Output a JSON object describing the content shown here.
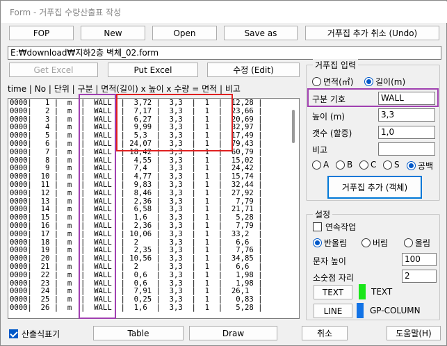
{
  "window": {
    "title": "Form - 거푸집 수량산출표 작성"
  },
  "toolbar": {
    "fop": "FOP",
    "new": "New",
    "open": "Open",
    "save_as": "Save as",
    "undo": "거푸집 추가 취소 (Undo)"
  },
  "path": "E:₩download₩지하2층 벽체_02.form",
  "actions": {
    "get_excel": "Get Excel",
    "put_excel": "Put Excel",
    "edit": "수정 (Edit)"
  },
  "list": {
    "header": "time | No | 단위 | 구분 | 면적(길이) x 높이 x 수량 = 면적 | 비고",
    "rows": [
      "0000|   1 |  m  |  WALL  |  3,72 |  3,3  |  1  |  12,28 |",
      "0000|   2 |  m  |  WALL  |  7,17 |  3,3  |  1  |  23,66 |",
      "0000|   3 |  m  |  WALL  |  6,27 |  3,3  |  1  |  20,69 |",
      "0000|   4 |  m  |  WALL  |  9,99 |  3,3  |  1  |  32,97 |",
      "0000|   5 |  m  |  WALL  |  5,3  |  3,3  |  1  |  17,49 |",
      "0000|   6 |  m  |  WALL  | 24,07 |  3,3  |  1  |  79,43 |",
      "0000|   7 |  m  |  WALL  | 18,42 |  3,3  |  1  |  60,79 |",
      "0000|   8 |  m  |  WALL  |  4,55 |  3,3  |  1  |  15,02 |",
      "0000|   9 |  m  |  WALL  |  7,4  |  3,3  |  1  |  24,42 |",
      "0000|  10 |  m  |  WALL  |  4,77 |  3,3  |  1  |  15,74 |",
      "0000|  11 |  m  |  WALL  |  9,83 |  3,3  |  1  |  32,44 |",
      "0000|  12 |  m  |  WALL  |  8,46 |  3,3  |  1  |  27,92 |",
      "0000|  13 |  m  |  WALL  |  2,36 |  3,3  |  1  |   7,79 |",
      "0000|  14 |  m  |  WALL  |  6,58 |  3,3  |  1  |  21,71 |",
      "0000|  15 |  m  |  WALL  |  1,6  |  3,3  |  1  |   5,28 |",
      "0000|  16 |  m  |  WALL  |  2,36 |  3,3  |  1  |   7,79 |",
      "0000|  17 |  m  |  WALL  | 10,06 |  3,3  |  1  |  33,2  |",
      "0000|  18 |  m  |  WALL  |  2    |  3,3  |  1  |   6,6  |",
      "0000|  19 |  m  |  WALL  |  2,35 |  3,3  |  1  |   7,76 |",
      "0000|  20 |  m  |  WALL  | 10,56 |  3,3  |  1  |  34,85 |",
      "0000|  21 |  m  |  WALL  |  2    |  3,3  |  1  |   6,6  |",
      "0000|  22 |  m  |  WALL  |  0,6  |  3,3  |  1  |   1,98 |",
      "0000|  23 |  m  |  WALL  |  0,6  |  3,3  |  1  |   1,98 |",
      "0000|  24 |  m  |  WALL  |  7,91 |  3,3  |  1  |  26,1  |",
      "0000|  25 |  m  |  WALL  |  0,25 |  3,3  |  1  |   0,83 |",
      "0000|  26 |  m  |  WALL  |  1,6  |  3,3  |  1  |   5,28 |"
    ]
  },
  "input_panel": {
    "title": "거푸집 입력",
    "mode_area": "면적(㎡)",
    "mode_length": "길이(m)",
    "category_label": "구분 기호",
    "category_value": "WALL",
    "height_label": "높이 (m)",
    "height_value": "3,3",
    "count_label": "갯수 (할증)",
    "count_value": "1,0",
    "note_label": "비고",
    "note_value": "",
    "opt_a": "A",
    "opt_b": "B",
    "opt_c": "C",
    "opt_s": "S",
    "opt_blank": "공백",
    "add_button": "거푸집 추가 (객체)"
  },
  "settings_panel": {
    "title": "설정",
    "continuous": "연속작업",
    "round": "반올림",
    "floor": "버림",
    "ceil": "올림",
    "text_height_label": "문자 높이",
    "text_height_value": "100",
    "decimal_label": "소숫점 자리",
    "decimal_value": "2",
    "text_button": "TEXT",
    "text_layer": "TEXT",
    "line_button": "LINE",
    "line_layer": "GP-COLUMN",
    "text_color": "#19e619",
    "line_color": "#1273e6"
  },
  "bottom": {
    "show_table": "산출식표기",
    "table": "Table",
    "draw": "Draw",
    "cancel": "취소",
    "help": "도움말(H)"
  }
}
